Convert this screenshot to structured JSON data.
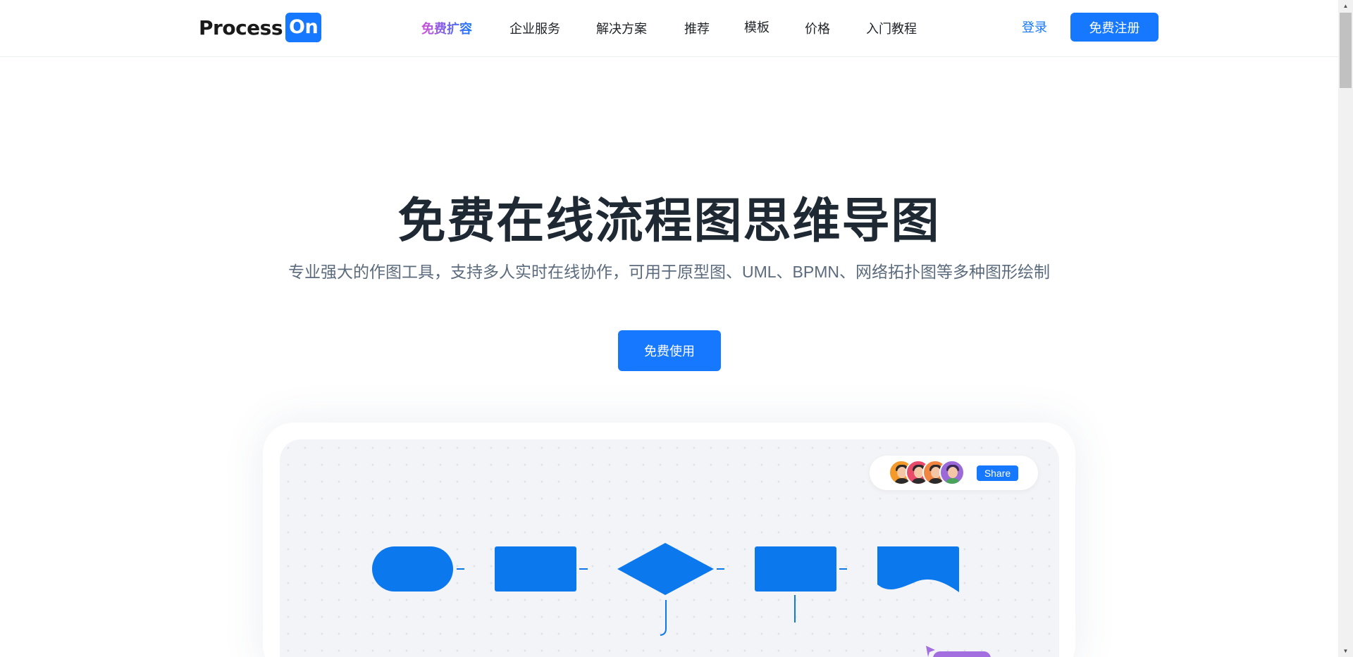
{
  "header": {
    "logo": {
      "process": "Process",
      "on": "On"
    },
    "nav": [
      {
        "label": "免费扩容",
        "hot": true
      },
      {
        "label": "企业服务"
      },
      {
        "label": "解决方案"
      },
      {
        "label": "推荐"
      },
      {
        "label": "模板"
      },
      {
        "label": "价格"
      },
      {
        "label": "入门教程"
      }
    ],
    "login_label": "登录",
    "register_label": "免费注册"
  },
  "hero": {
    "title": "免费在线流程图思维导图",
    "subtitle": "专业强大的作图工具，支持多人实时在线协作，可用于原型图、UML、BPMN、网络拓扑图等多种图形绘制",
    "cta_label": "免费使用"
  },
  "demo": {
    "share_label": "Share",
    "avatars": [
      {
        "name": "collaborator-1",
        "color": "#f39a2b"
      },
      {
        "name": "collaborator-2",
        "color": "#e94b6a"
      },
      {
        "name": "collaborator-3",
        "color": "#f08542"
      },
      {
        "name": "collaborator-4",
        "color": "#9b6ad8"
      }
    ],
    "flow_shapes": [
      "terminator",
      "process",
      "decision",
      "process",
      "document"
    ],
    "shape_color": "#0b78ee",
    "cursor_color": "#a36ee0"
  },
  "colors": {
    "accent": "#1677ff",
    "title": "#1f2933",
    "subtitle": "#5b6b7d"
  }
}
